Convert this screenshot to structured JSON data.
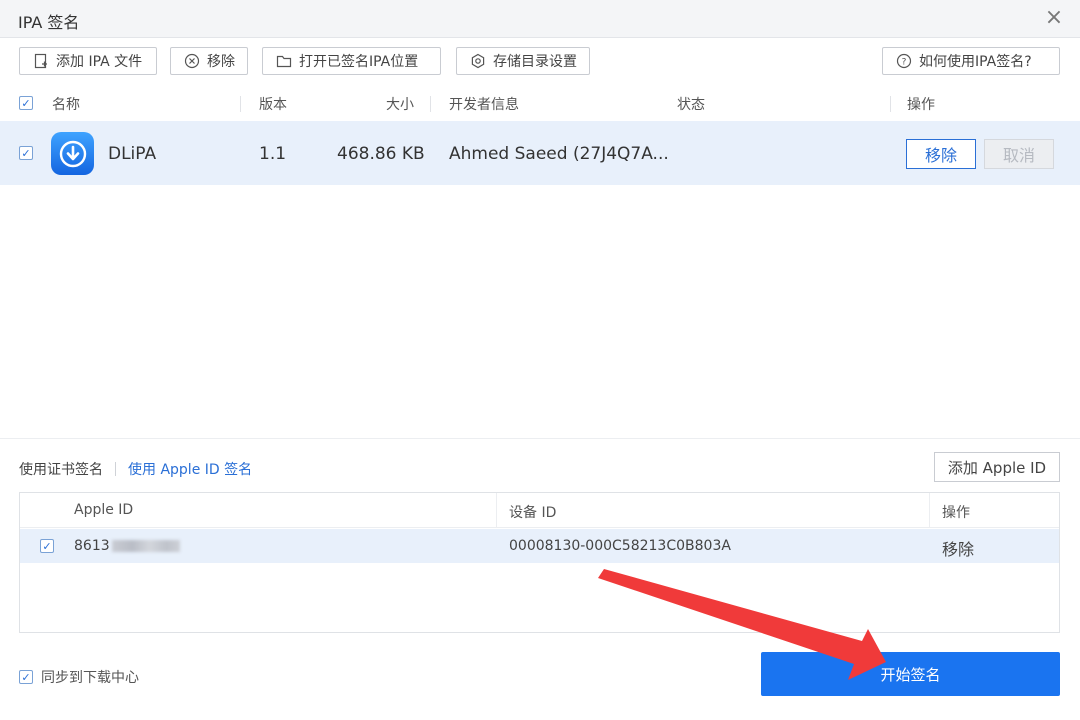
{
  "window": {
    "title": "IPA 签名",
    "close_icon": "×"
  },
  "toolbar": {
    "add_ipa": "添加 IPA 文件",
    "remove": "移除",
    "open_signed_location": "打开已签名IPA位置",
    "storage_settings": "存储目录设置",
    "how_to": "如何使用IPA签名?"
  },
  "file_table": {
    "columns": [
      "名称",
      "版本",
      "大小",
      "开发者信息",
      "状态",
      "操作"
    ],
    "rows": [
      {
        "checked": true,
        "name": "DLiPA",
        "version": "1.1",
        "size": "468.86 KB",
        "developer": "Ahmed Saeed (27J4Q7A...",
        "status": "",
        "remove_label": "移除",
        "cancel_label": "取消"
      }
    ]
  },
  "sign_mode": {
    "cert_tab": "使用证书签名",
    "appleid_tab": "使用 Apple ID 签名",
    "add_apple_id": "添加 Apple ID"
  },
  "account_table": {
    "columns": [
      "Apple ID",
      "设备 ID",
      "操作"
    ],
    "rows": [
      {
        "checked": true,
        "apple_id_prefix": "8613",
        "device_id": "00008130-000C58213C0B803A",
        "action": "移除"
      }
    ]
  },
  "footer": {
    "sync_label": "同步到下载中心",
    "sync_checked": true,
    "start_label": "开始签名"
  },
  "colors": {
    "accent": "#1a74f0",
    "selected_row": "#e8f0fb",
    "arrow": "#f03a3a"
  }
}
